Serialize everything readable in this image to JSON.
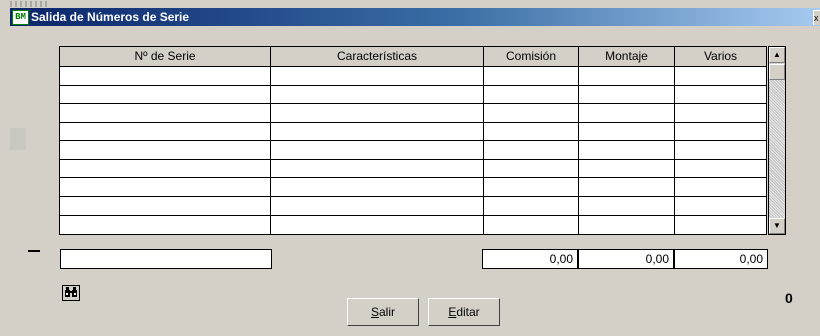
{
  "window": {
    "title": "Salida de Números de Serie",
    "icon_text": "BM",
    "close_glyph": "x"
  },
  "grid": {
    "columns": [
      "Nº de Serie",
      "Características",
      "Comisión",
      "Montaje",
      "Varios"
    ],
    "row_count": 9
  },
  "totals": {
    "serie": "",
    "comision": "0,00",
    "montaje": "0,00",
    "varios": "0,00"
  },
  "buttons": {
    "salir": "Salir",
    "salir_mnemonic": "S",
    "editar": "Editar",
    "editar_mnemonic": "E"
  },
  "count": "0",
  "icons": {
    "search": "binoculars-icon"
  }
}
